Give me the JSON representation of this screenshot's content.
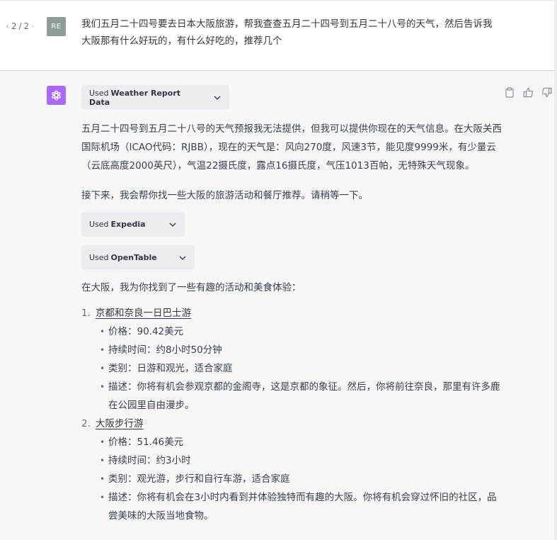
{
  "user_turn": {
    "pager": {
      "current": "2",
      "total": "2",
      "separator": "/"
    },
    "avatar_initials": "RE",
    "text": "我们五月二十四号要去日本大阪旅游，帮我查查五月二十四号到五月二十八号的天气，然后告诉我大阪那有什么好玩的，有什么好吃的，推荐几个"
  },
  "assistant_turn": {
    "avatar_icon": "openai-logo-icon",
    "avatar_color": "#ab68ff",
    "actions": [
      {
        "name": "copy",
        "icon": "clipboard-icon"
      },
      {
        "name": "thumbs-up",
        "icon": "thumbs-up-icon"
      },
      {
        "name": "thumbs-down",
        "icon": "thumbs-down-icon"
      }
    ],
    "plugin_used_prefix": "Used",
    "plugins": [
      {
        "name": "Weather Report Data"
      },
      {
        "name": "Expedia"
      },
      {
        "name": "OpenTable"
      }
    ],
    "weather_paragraph": "五月二十四号到五月二十八号的天气预报我无法提供，但我可以提供你现在的天气信息。在大阪关西国际机场（ICAO代码：RJBB），现在的天气是：风向270度，风速3节，能见度9999米，有少量云（云底高度2000英尺），气温22摄氏度，露点16摄氏度，气压1013百帕，无特殊天气现象。",
    "next_paragraph": "接下来，我会帮你找一些大阪的旅游活动和餐厅推荐。请稍等一下。",
    "intro_paragraph": "在大阪，我为你找到了一些有趣的活动和美食体验：",
    "recommendations": [
      {
        "number": "1.",
        "title": "京都和奈良一日巴士游",
        "details": [
          "价格：90.42美元",
          "持续时间：约8小时50分钟",
          "类别：日游和观光，适合家庭",
          "描述：你将有机会参观京都的金阁寺，这是京都的象征。然后，你将前往奈良，那里有许多鹿在公园里自由漫步。"
        ]
      },
      {
        "number": "2.",
        "title": "大阪步行游",
        "details": [
          "价格：51.46美元",
          "持续时间：约3小时",
          "类别：观光游，步行和自行车游，适合家庭",
          "描述：你将有机会在3小时内看到并体验独特而有趣的大阪。你将有机会穿过怀旧的社区，品尝美味的大阪当地食物。"
        ]
      }
    ],
    "bullet_glyph": "•"
  }
}
